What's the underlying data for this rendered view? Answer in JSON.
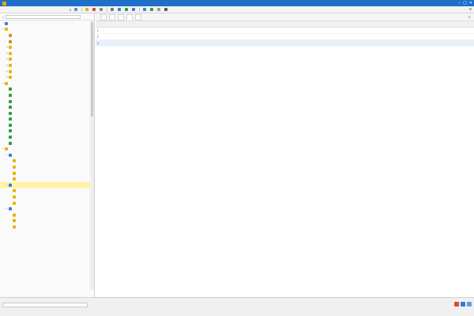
{
  "window": {
    "title": "",
    "controls": [
      "–",
      "□",
      "✕"
    ]
  },
  "colors": {
    "titlebar": "#1f6fc8",
    "selection": "#fff3a8",
    "link": "#2a4fa8",
    "folder": "#e8b400",
    "accent_red": "#e2473a"
  },
  "toolbar": {
    "dropdown_glyph": "v",
    "items": [
      {
        "label": "",
        "icon": "document-icon"
      },
      {
        "label": "",
        "icon": "folder-open-icon"
      },
      {
        "label": "",
        "icon": "edit-icon"
      },
      {
        "label": "",
        "icon": "gear-icon"
      },
      {
        "label": "",
        "icon": "print-icon"
      },
      {
        "label": "",
        "icon": "list-icon"
      },
      {
        "label": "",
        "icon": "bar-chart-icon"
      },
      {
        "label": "",
        "icon": "table-icon"
      },
      {
        "label": "",
        "icon": "search-icon"
      },
      {
        "label": "",
        "icon": "refresh-icon"
      },
      {
        "label": "",
        "icon": "filter-icon"
      },
      {
        "label": "",
        "icon": "radio-icon"
      }
    ],
    "chevron": "v"
  },
  "left": {
    "search_placeholder": "",
    "tree": [
      {
        "depth": 0,
        "label": "",
        "icon": "database-icon",
        "expanded": true
      },
      {
        "depth": 0,
        "label": "",
        "icon": "folder-icon",
        "expanded": true
      },
      {
        "depth": 1,
        "label": "",
        "icon": "user-icon"
      },
      {
        "depth": 1,
        "label": "",
        "icon": "user-icon"
      },
      {
        "depth": 1,
        "label": "",
        "icon": "folder-icon",
        "expanded": false
      },
      {
        "depth": 1,
        "label": "",
        "icon": "folder-icon",
        "expanded": false
      },
      {
        "depth": 1,
        "label": "",
        "icon": "folder-icon",
        "expanded": false
      },
      {
        "depth": 1,
        "label": "",
        "icon": "folder-icon",
        "expanded": false
      },
      {
        "depth": 1,
        "label": "",
        "icon": "folder-icon",
        "expanded": false
      },
      {
        "depth": 1,
        "label": "",
        "icon": "folder-icon",
        "expanded": false
      },
      {
        "depth": 0,
        "label": "",
        "icon": "folder-icon",
        "expanded": true
      },
      {
        "depth": 1,
        "label": "",
        "icon": "leaf-icon"
      },
      {
        "depth": 1,
        "label": "",
        "icon": "leaf-icon"
      },
      {
        "depth": 1,
        "label": "",
        "icon": "leaf-icon"
      },
      {
        "depth": 1,
        "label": "",
        "icon": "leaf-icon"
      },
      {
        "depth": 1,
        "label": "",
        "icon": "leaf-icon"
      },
      {
        "depth": 1,
        "label": "",
        "icon": "leaf-icon"
      },
      {
        "depth": 1,
        "label": "",
        "icon": "leaf-icon"
      },
      {
        "depth": 1,
        "label": "",
        "icon": "leaf-icon"
      },
      {
        "depth": 1,
        "label": "",
        "icon": "leaf-icon"
      },
      {
        "depth": 1,
        "label": "",
        "icon": "leaf-icon"
      },
      {
        "depth": 0,
        "label": "",
        "icon": "folder-icon",
        "expanded": true
      },
      {
        "depth": 1,
        "label": "",
        "icon": "user-group-icon",
        "expanded": true
      },
      {
        "depth": 2,
        "label": "",
        "icon": "folder-icon"
      },
      {
        "depth": 2,
        "label": "",
        "icon": "folder-icon"
      },
      {
        "depth": 2,
        "label": "",
        "icon": "folder-icon"
      },
      {
        "depth": 2,
        "label": "",
        "icon": "folder-icon"
      },
      {
        "depth": 1,
        "label": "",
        "icon": "user-group-icon",
        "expanded": true,
        "selected": true
      },
      {
        "depth": 2,
        "label": "",
        "icon": "folder-icon"
      },
      {
        "depth": 2,
        "label": "",
        "icon": "folder-icon"
      },
      {
        "depth": 2,
        "label": "",
        "icon": "folder-icon"
      },
      {
        "depth": 1,
        "label": "",
        "icon": "user-group-icon",
        "expanded": true
      },
      {
        "depth": 2,
        "label": "",
        "icon": "folder-icon"
      },
      {
        "depth": 2,
        "label": "",
        "icon": "folder-icon"
      },
      {
        "depth": 2,
        "label": "",
        "icon": "folder-icon"
      }
    ]
  },
  "right": {
    "tabs": [
      "",
      "",
      "",
      "",
      ""
    ],
    "active_tab": 3,
    "refresh_glyph": "↻",
    "columns": [
      "",
      "",
      "",
      "",
      "",
      "",
      "",
      "",
      "",
      "",
      "",
      ""
    ],
    "rows": [
      {
        "cells": [
          "1",
          "",
          "",
          "",
          "",
          "",
          "",
          "",
          "",
          "",
          "",
          ""
        ]
      },
      {
        "cells": [
          "2",
          "",
          "",
          "",
          "",
          "",
          "",
          "",
          "",
          "",
          "",
          ""
        ]
      },
      {
        "cells": [
          "3",
          "",
          "",
          "",
          "",
          "",
          "",
          "",
          "",
          "",
          "",
          ""
        ],
        "selected": true
      }
    ]
  },
  "status": {
    "path": ""
  }
}
